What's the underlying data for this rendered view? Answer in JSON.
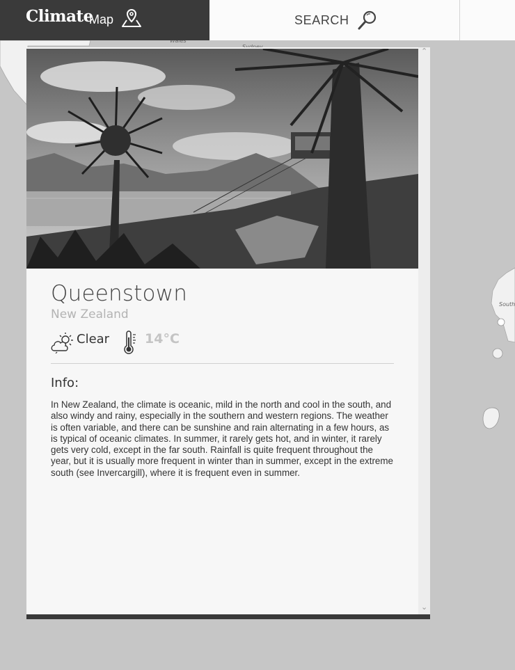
{
  "header": {
    "brand_strong": "Climate",
    "brand_light": "Map",
    "brand_icon": "map-pin-icon",
    "search_label": "SEARCH",
    "search_icon": "magnifier-icon"
  },
  "map": {
    "labels": [
      "Wales",
      "Sydney",
      "South"
    ]
  },
  "place": {
    "city": "Queenstown",
    "country": "New Zealand",
    "weather_icon": "partly-cloudy-icon",
    "condition": "Clear",
    "thermometer_icon": "thermometer-icon",
    "temperature": "14°C"
  },
  "info": {
    "heading": "Info:",
    "text": "In New Zealand, the climate is oceanic, mild in the north and cool in the south, and also windy and rainy, especially in the southern and western regions. The weather is often variable, and there can be sunshine and rain alternating in a few hours, as is typical of oceanic climates. In summer, it rarely gets hot, and in winter, it rarely gets very cold, except in the far south. Rainfall is quite frequent throughout the year, but it is usually more frequent in winter than in summer, except in the extreme south (see Invercargill), where it is frequent even in summer."
  },
  "colors": {
    "header_dark": "#3a3a3a",
    "map_sea": "#c6c6c6",
    "land": "#f2f2f2",
    "panel_bg": "#f7f7f7"
  }
}
